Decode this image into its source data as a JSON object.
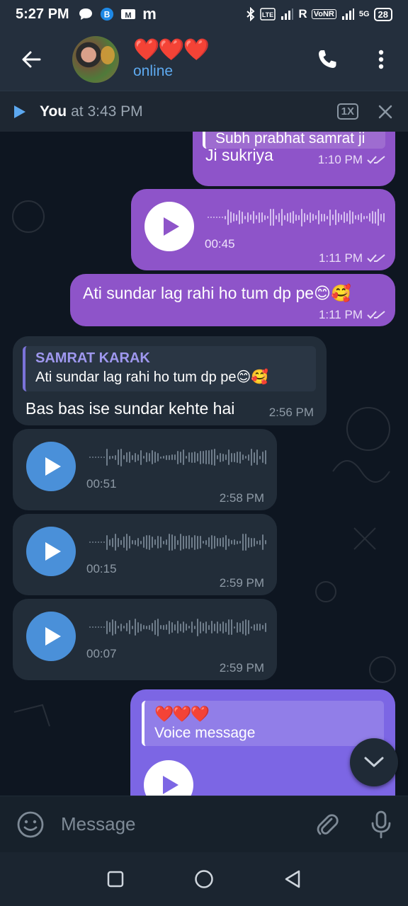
{
  "status_bar": {
    "time": "5:27 PM",
    "left_icons": [
      "chat-bubble-icon",
      "b-circle-icon",
      "m-logo-icon",
      "m-icon"
    ],
    "right_text": "R",
    "network": "VoNR",
    "network_gen": "5G",
    "battery": "28"
  },
  "header": {
    "title": "❤️❤️❤️",
    "status": "online"
  },
  "player_bar": {
    "who": "You",
    "when": "at 3:43 PM",
    "speed": "1X"
  },
  "messages": {
    "m1": {
      "reply_text": "Subh prabhat samrat ji",
      "text": "Ji sukriya",
      "time": "1:10 PM"
    },
    "m2": {
      "duration": "00:45",
      "time": "1:11 PM"
    },
    "m3": {
      "text": "Ati sundar lag rahi ho tum dp pe😊🥰",
      "time": "1:11 PM"
    },
    "m4": {
      "reply_name": "SAMRAT KARAK",
      "reply_text": "Ati sundar lag rahi ho tum dp pe😊🥰",
      "text": "Bas bas ise sundar kehte hai",
      "time": "2:56 PM"
    },
    "m5": {
      "duration": "00:51",
      "time": "2:58 PM"
    },
    "m6": {
      "duration": "00:15",
      "time": "2:59 PM"
    },
    "m7": {
      "duration": "00:07",
      "time": "2:59 PM"
    },
    "m8": {
      "reply_name": "❤️❤️❤️",
      "reply_text": "Voice message"
    }
  },
  "input": {
    "placeholder": "Message"
  },
  "colors": {
    "outgoing": "#8e54c9",
    "incoming": "#222d39",
    "accent": "#5eaaf0",
    "background": "#0e1621"
  }
}
